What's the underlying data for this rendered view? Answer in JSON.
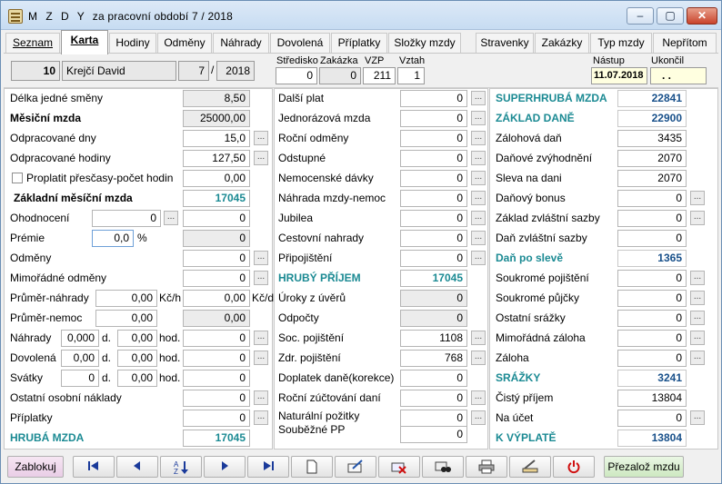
{
  "window": {
    "app_name": "M Z D Y",
    "subtitle": "za pracovní období  7 / 2018",
    "min": "–",
    "max": "▢",
    "close": "✕"
  },
  "tabs": [
    "Seznam",
    "Karta",
    "Hodiny",
    "Odměny",
    "Náhrady",
    "Dovolená",
    "Příplatky",
    "Složky mzdy",
    "Stravenky",
    "Zakázky",
    "Typ mzdy",
    "Nepřítom"
  ],
  "header": {
    "emp_no": "10",
    "emp_name": "Krejčí David",
    "month": "7",
    "slash": "/",
    "year": "2018",
    "stredisko_lbl": "Středisko",
    "stredisko": "0",
    "zakazka_lbl": "Zakázka",
    "zakazka": "0",
    "vzp_lbl": "VZP",
    "vzp": "211",
    "vztah_lbl": "Vztah",
    "vztah": "1",
    "nastup_lbl": "Nástup",
    "nastup": "11.07.2018",
    "ukonceni_lbl": "Ukončil",
    "ukonceni": ". ."
  },
  "left": {
    "delka_lbl": "Délka jedné směny",
    "delka": "8,50",
    "mesicni_lbl": "Měsiční mzda",
    "mesicni": "25000,00",
    "odpr_dny_lbl": "Odpracované dny",
    "odpr_dny": "15,0",
    "odpr_hod_lbl": "Odpracované hodiny",
    "odpr_hod": "127,50",
    "proplatit_lbl": "Proplatit přesčasy-počet hodin",
    "proplatit": "0,00",
    "zakl_lbl": "Základní měsíční mzda",
    "zakl": "17045",
    "ohod_lbl": "Ohodnocení",
    "ohod_in": "0",
    "ohod": "0",
    "premie_lbl": "Prémie",
    "premie_in": "0,0",
    "pct": "%",
    "premie": "0",
    "odmeny_lbl": "Odměny",
    "odmeny": "0",
    "mimo_lbl": "Mimořádné odměny",
    "mimo": "0",
    "prum_nah_lbl": "Průměr-náhrady",
    "prum_nah": "0,00",
    "kch": "Kč/h",
    "prum_nah2": "0,00",
    "kcd": "Kč/d",
    "prum_nem_lbl": "Průměr-nemoc",
    "prum_nem": "0,00",
    "prum_nem2": "0,00",
    "nahrady_lbl": "Náhrady",
    "nah_d": "0,000",
    "d1": "d.",
    "nah_h": "0,00",
    "hod1": "hod.",
    "nahrady": "0",
    "dovolena_lbl": "Dovolená",
    "dov_d": "0,00",
    "d2": "d.",
    "dov_h": "0,00",
    "hod2": "hod.",
    "dovolena": "0",
    "svatky_lbl": "Svátky",
    "sv_d": "0",
    "d3": "d.",
    "sv_h": "0,00",
    "hod3": "hod.",
    "svatky": "0",
    "ostatni_lbl": "Ostatní osobní náklady",
    "ostatni": "0",
    "priplatky_lbl": "Příplatky",
    "priplatky": "0",
    "hruba_lbl": "HRUBÁ MZDA",
    "hruba": "17045"
  },
  "middle": [
    {
      "label": "Další plat",
      "value": "0",
      "btn": true
    },
    {
      "label": "Jednorázová mzda",
      "value": "0",
      "btn": true
    },
    {
      "label": "Roční odměny",
      "value": "0",
      "btn": true
    },
    {
      "label": "Odstupné",
      "value": "0",
      "btn": true
    },
    {
      "label": "Nemocenské dávky",
      "value": "0",
      "btn": true
    },
    {
      "label": "Náhrada mzdy-nemoc",
      "value": "0",
      "btn": true
    },
    {
      "label": "Jubilea",
      "value": "0",
      "btn": true
    },
    {
      "label": "Cestovní nahrady",
      "value": "0",
      "btn": true
    },
    {
      "label": "Připojištění",
      "value": "0",
      "btn": true
    },
    {
      "label": "HRUBÝ PŘÍJEM",
      "value": "17045",
      "btn": false
    },
    {
      "label": "Úroky z úvěrů",
      "value": "0",
      "btn": false
    },
    {
      "label": "Odpočty",
      "value": "0",
      "btn": false
    },
    {
      "label": "Soc. pojištění",
      "value": "1108",
      "btn": true
    },
    {
      "label": "Zdr. pojištění",
      "value": "768",
      "btn": true
    },
    {
      "label": "Doplatek daně(korekce)",
      "value": "0",
      "btn": false
    },
    {
      "label": "Roční zúčtování daní",
      "value": "0",
      "btn": true
    },
    {
      "label": "Naturální požitky",
      "value": "0",
      "btn": true
    },
    {
      "label": "Souběžné PP",
      "value": "0",
      "btn": false
    }
  ],
  "right": [
    {
      "label": "SUPERHRUBÁ MZDA",
      "value": "22841",
      "btn": false
    },
    {
      "label": "ZÁKLAD DANĚ",
      "value": "22900",
      "btn": false
    },
    {
      "label": "Zálohová daň",
      "value": "3435",
      "btn": false
    },
    {
      "label": "Daňové zvýhodnění",
      "value": "2070",
      "btn": false
    },
    {
      "label": "Sleva na dani",
      "value": "2070",
      "btn": false
    },
    {
      "label": "Daňový bonus",
      "value": "0",
      "btn": true
    },
    {
      "label": "Základ zvláštní sazby",
      "value": "0",
      "btn": true
    },
    {
      "label": "Daň zvláštní sazby",
      "value": "0",
      "btn": false
    },
    {
      "label": "Daň po slevě",
      "value": "1365",
      "btn": false
    },
    {
      "label": "Soukromé pojištění",
      "value": "0",
      "btn": true
    },
    {
      "label": "Soukromé půjčky",
      "value": "0",
      "btn": true
    },
    {
      "label": "Ostatní srážky",
      "value": "0",
      "btn": true
    },
    {
      "label": "Mimořádná záloha",
      "value": "0",
      "btn": true
    },
    {
      "label": "Záloha",
      "value": "0",
      "btn": true
    },
    {
      "label": "SRÁŽKY",
      "value": "3241",
      "btn": false
    },
    {
      "label": "Čistý příjem",
      "value": "13804",
      "btn": false
    },
    {
      "label": "Na účet",
      "value": "0",
      "btn": true
    },
    {
      "label": "K VÝPLATĚ",
      "value": "13804",
      "btn": false
    }
  ],
  "toolbar": {
    "zablokuj": "Zablokuj",
    "prezaloz": "Přezalož mzdu",
    "dots": "..."
  },
  "colors": {
    "teal": "#1b8a93",
    "blue": "#18508a",
    "title": "#c7dcf2"
  }
}
